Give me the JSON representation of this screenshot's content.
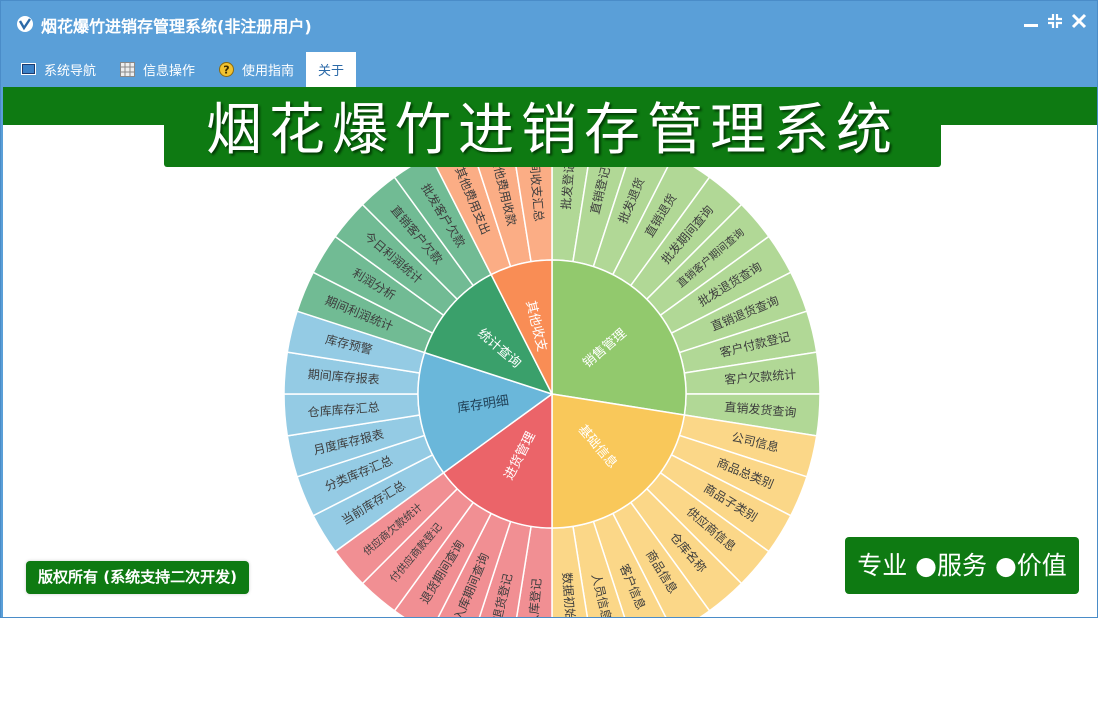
{
  "window": {
    "title": "烟花爆竹进销存管理系统(非注册用户)"
  },
  "menu": [
    {
      "label": "系统导航",
      "icon": "monitor-icon"
    },
    {
      "label": "信息操作",
      "icon": "grid-icon"
    },
    {
      "label": "使用指南",
      "icon": "help-icon"
    },
    {
      "label": "关于",
      "icon": ""
    }
  ],
  "banner": {
    "title": "烟花爆竹进销存管理系统"
  },
  "footer": {
    "copyright": "版权所有 (系统支持二次开发)",
    "slogan": "专业 ●服务 ●价值"
  },
  "colors": {
    "accent_green": "#0e7a12",
    "title_blue": "#5a9fd8",
    "sales": "#92c96d",
    "basic": "#f9c85a",
    "purchase": "#eb6469",
    "stock": "#6ab7da",
    "stats": "#3aa06b",
    "other": "#f98d55"
  },
  "wheel": {
    "center": [
      {
        "label": "销售管理",
        "color": "#92c96d",
        "children": [
          "批发登记",
          "直销登记",
          "批发退货",
          "直销退货",
          "批发期间查询",
          "直销客户期间查询",
          "批发退货查询",
          "直销退货查询",
          "客户付款登记",
          "客户欠款统计",
          "直销发货查询"
        ]
      },
      {
        "label": "基础信息",
        "color": "#f9c85a",
        "children": [
          "公司信息",
          "商品总类别",
          "商品子类别",
          "供应商信息",
          "仓库名称",
          "商品信息",
          "客户信息",
          "人员信息",
          "数据初始化"
        ]
      },
      {
        "label": "进货管理",
        "color": "#eb6469",
        "children": [
          "入库登记",
          "退货登记",
          "入库期间查询",
          "退货期间查询",
          "付供应商款登记",
          "供应商欠款统计"
        ]
      },
      {
        "label": "库存明细",
        "color": "#6ab7da",
        "children": [
          "当前库存汇总",
          "分类库存汇总",
          "月度库存报表",
          "仓库库存汇总",
          "期间库存报表",
          "库存预警"
        ]
      },
      {
        "label": "统计查询",
        "color": "#3aa06b",
        "children": [
          "期间利润统计",
          "利润分析",
          "今日利润统计",
          "直销客户欠款",
          "批发客户欠款"
        ]
      },
      {
        "label": "其他收支",
        "color": "#f98d55",
        "children": [
          "其他费用支出",
          "其他费用收款",
          "期间收支汇总"
        ]
      }
    ]
  }
}
